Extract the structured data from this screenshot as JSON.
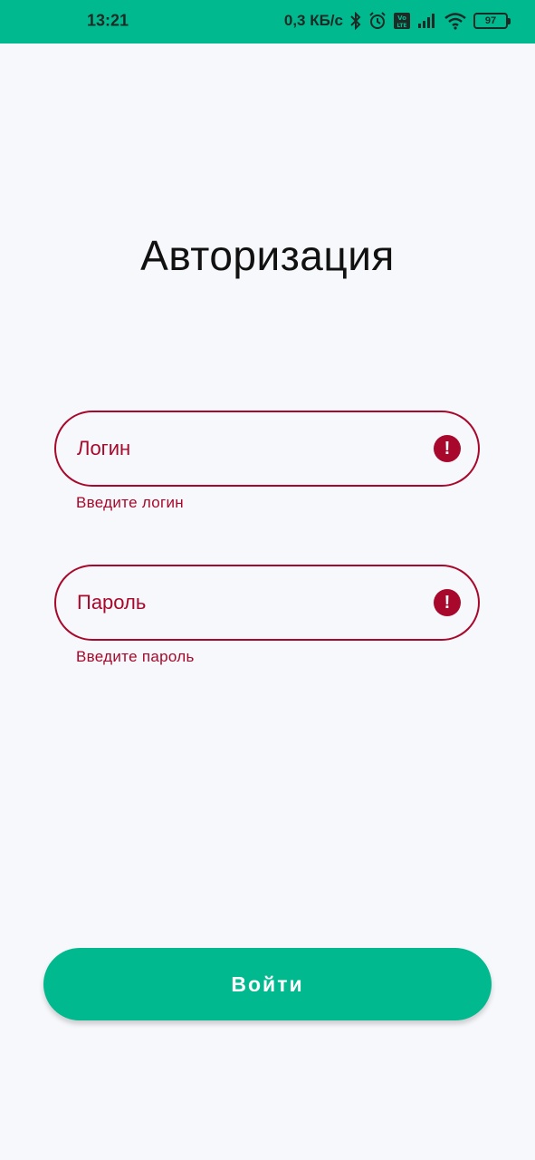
{
  "status_bar": {
    "time": "13:21",
    "net_speed": "0,3 КБ/с",
    "battery": "97",
    "icons": [
      "bluetooth-icon",
      "alarm-icon",
      "volte-icon",
      "signal-icon",
      "wifi-icon",
      "battery-icon"
    ]
  },
  "page": {
    "title": "Авторизация"
  },
  "login_field": {
    "placeholder": "Логин",
    "error": "Введите логин"
  },
  "password_field": {
    "placeholder": "Пароль",
    "error": "Введите пароль"
  },
  "login_button": {
    "label": "Войти"
  },
  "colors": {
    "accent": "#00b98f",
    "error": "#a8082b",
    "background": "#f7f8fb"
  }
}
